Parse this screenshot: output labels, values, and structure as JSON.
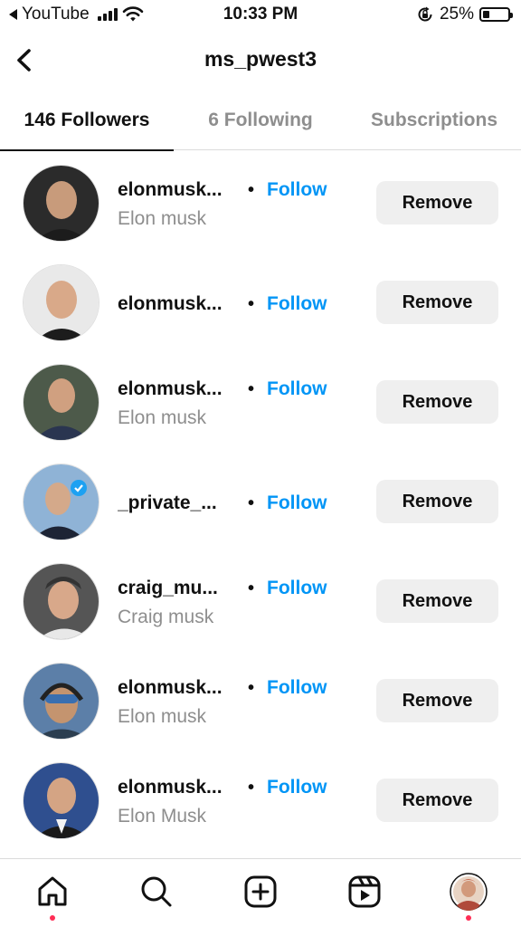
{
  "status_bar": {
    "back_app": "YouTube",
    "time": "10:33 PM",
    "battery": "25%",
    "battery_level": 0.25
  },
  "header": {
    "title": "ms_pwest3",
    "back_icon": "chevron-left-icon"
  },
  "tabs": [
    {
      "label": "146 Followers",
      "active": true
    },
    {
      "label": "6 Following",
      "active": false
    },
    {
      "label": "Subscriptions",
      "active": false
    }
  ],
  "followers": [
    {
      "username": "elonmusk...",
      "fullname": "Elon musk",
      "follow_label": "Follow",
      "remove_label": "Remove",
      "avatar_colors": [
        "#2b2b2b",
        "#c89b7b"
      ]
    },
    {
      "username": "elonmusk...",
      "fullname": "",
      "follow_label": "Follow",
      "remove_label": "Remove",
      "avatar_colors": [
        "#e9e9e9",
        "#d9a989"
      ]
    },
    {
      "username": "elonmusk...",
      "fullname": "Elon musk",
      "follow_label": "Follow",
      "remove_label": "Remove",
      "avatar_colors": [
        "#4d5a4a",
        "#d0a080"
      ]
    },
    {
      "username": "_private_...",
      "fullname": "",
      "follow_label": "Follow",
      "remove_label": "Remove",
      "avatar_colors": [
        "#8fb3d6",
        "#d4a98a"
      ]
    },
    {
      "username": "craig_mu...",
      "fullname": "Craig musk",
      "follow_label": "Follow",
      "remove_label": "Remove",
      "avatar_colors": [
        "#555555",
        "#d8a88a"
      ]
    },
    {
      "username": "elonmusk...",
      "fullname": "Elon musk",
      "follow_label": "Follow",
      "remove_label": "Remove",
      "avatar_colors": [
        "#5c7fa8",
        "#c4946f"
      ]
    },
    {
      "username": "elonmusk...",
      "fullname": "Elon Musk",
      "follow_label": "Follow",
      "remove_label": "Remove",
      "avatar_colors": [
        "#2f4f8f",
        "#d4a484"
      ]
    }
  ],
  "bottom_nav": [
    {
      "icon": "home-icon",
      "notification_dot": true
    },
    {
      "icon": "search-icon",
      "notification_dot": false
    },
    {
      "icon": "create-post-icon",
      "notification_dot": false
    },
    {
      "icon": "reels-icon",
      "notification_dot": false
    },
    {
      "icon": "profile-avatar-icon",
      "notification_dot": true
    }
  ],
  "colors": {
    "accent": "#0095f6",
    "button_bg": "#efefef",
    "secondary_text": "#8e8e8e",
    "notification_dot": "#ff2d55"
  }
}
